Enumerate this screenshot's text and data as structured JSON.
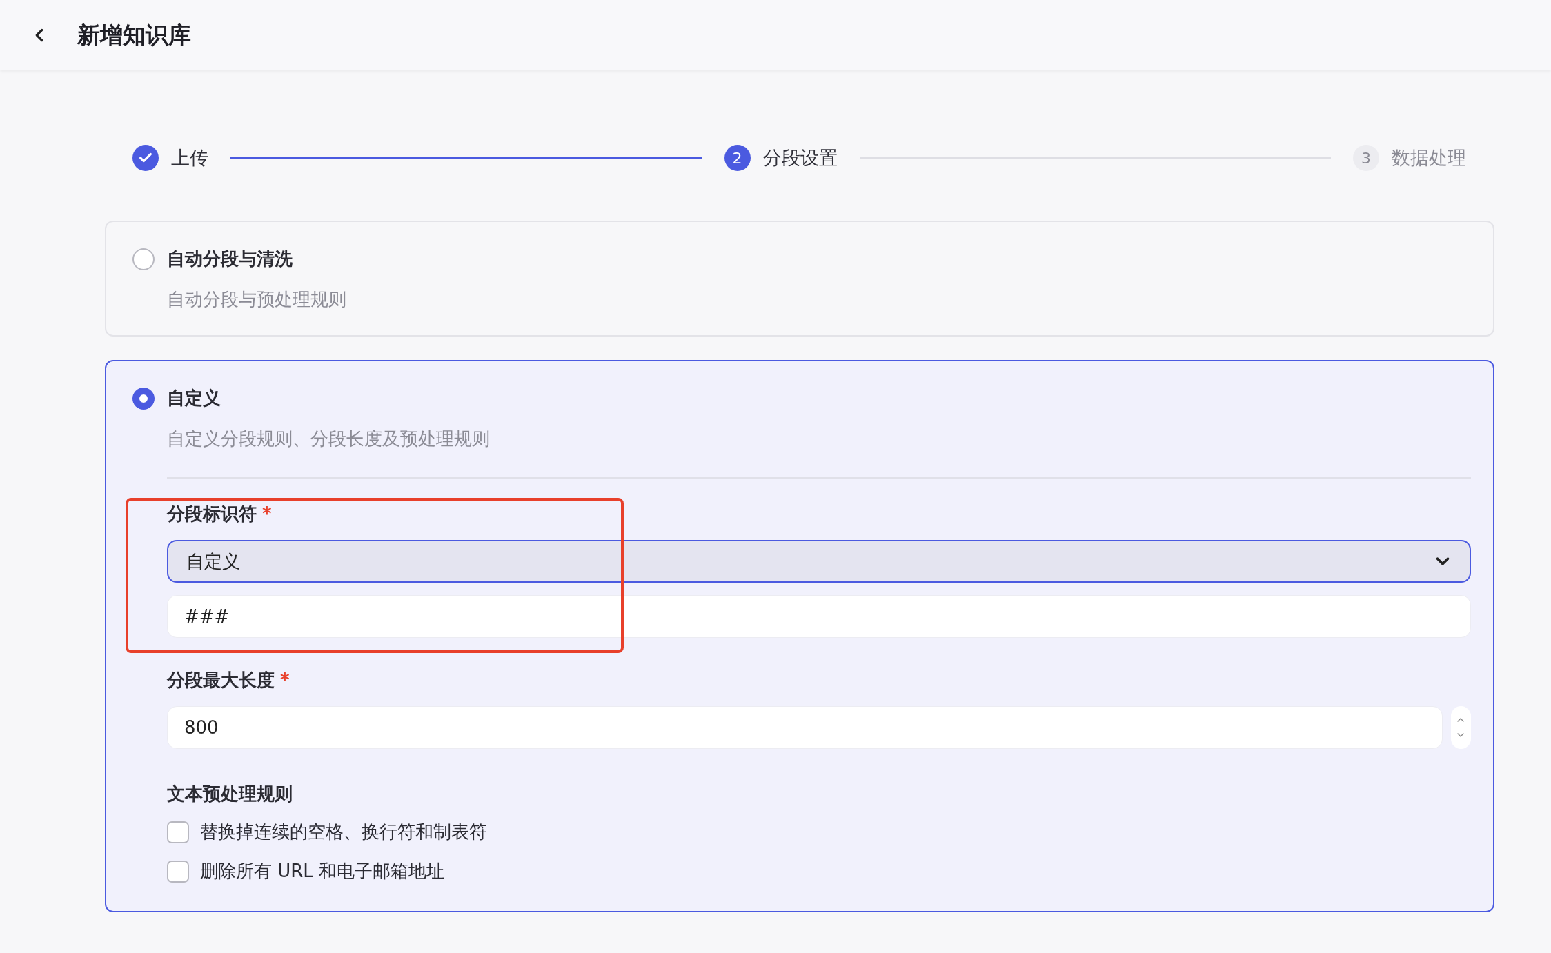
{
  "header": {
    "title": "新增知识库"
  },
  "steps": [
    {
      "label": "上传",
      "kind": "done"
    },
    {
      "number": "2",
      "label": "分段设置",
      "kind": "current"
    },
    {
      "number": "3",
      "label": "数据处理",
      "kind": "pending"
    }
  ],
  "options": [
    {
      "title": "自动分段与清洗",
      "description": "自动分段与预处理规则",
      "selected": false
    },
    {
      "title": "自定义",
      "description": "自定义分段规则、分段长度及预处理规则",
      "selected": true
    }
  ],
  "separator_field": {
    "label": "分段标识符",
    "required_mark": "*",
    "highlighted": true,
    "select_value": "自定义",
    "input_value": "###"
  },
  "max_length_field": {
    "label": "分段最大长度",
    "required_mark": "*",
    "value": "800"
  },
  "preprocess": {
    "title": "文本预处理规则",
    "rules": [
      {
        "label": "替换掉连续的空格、换行符和制表符",
        "checked": false
      },
      {
        "label": "删除所有 URL 和电子邮箱地址",
        "checked": false
      }
    ]
  }
}
